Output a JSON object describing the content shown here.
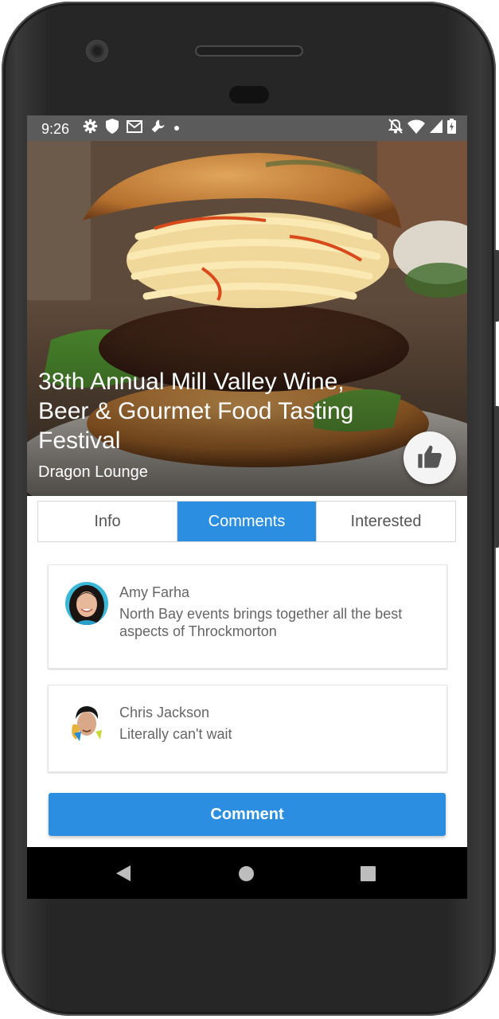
{
  "status_bar": {
    "time": "9:26",
    "left_icons": [
      "gear-icon",
      "shield-icon",
      "mail-icon",
      "wrench-icon",
      "dot-icon"
    ],
    "right_icons": [
      "bell-off-icon",
      "wifi-icon",
      "signal-icon",
      "battery-charging-icon"
    ]
  },
  "event": {
    "title": "38th Annual Mill Valley Wine, Beer & Gourmet Food Tasting Festival",
    "venue": "Dragon Lounge",
    "image": "burger-photo"
  },
  "tabs": [
    {
      "label": "Info",
      "active": false
    },
    {
      "label": "Comments",
      "active": true
    },
    {
      "label": "Interested",
      "active": false
    }
  ],
  "comments": [
    {
      "name": "Amy Farha",
      "text": "North Bay events brings together all the best aspects of Throckmorton"
    },
    {
      "name": "Chris Jackson",
      "text": "Literally can't wait"
    }
  ],
  "actions": {
    "comment_label": "Comment",
    "like_icon": "thumbs-up-icon"
  },
  "colors": {
    "accent": "#2b8ee0",
    "status_bar": "#5b5b5b",
    "nav_bar": "#000000"
  }
}
